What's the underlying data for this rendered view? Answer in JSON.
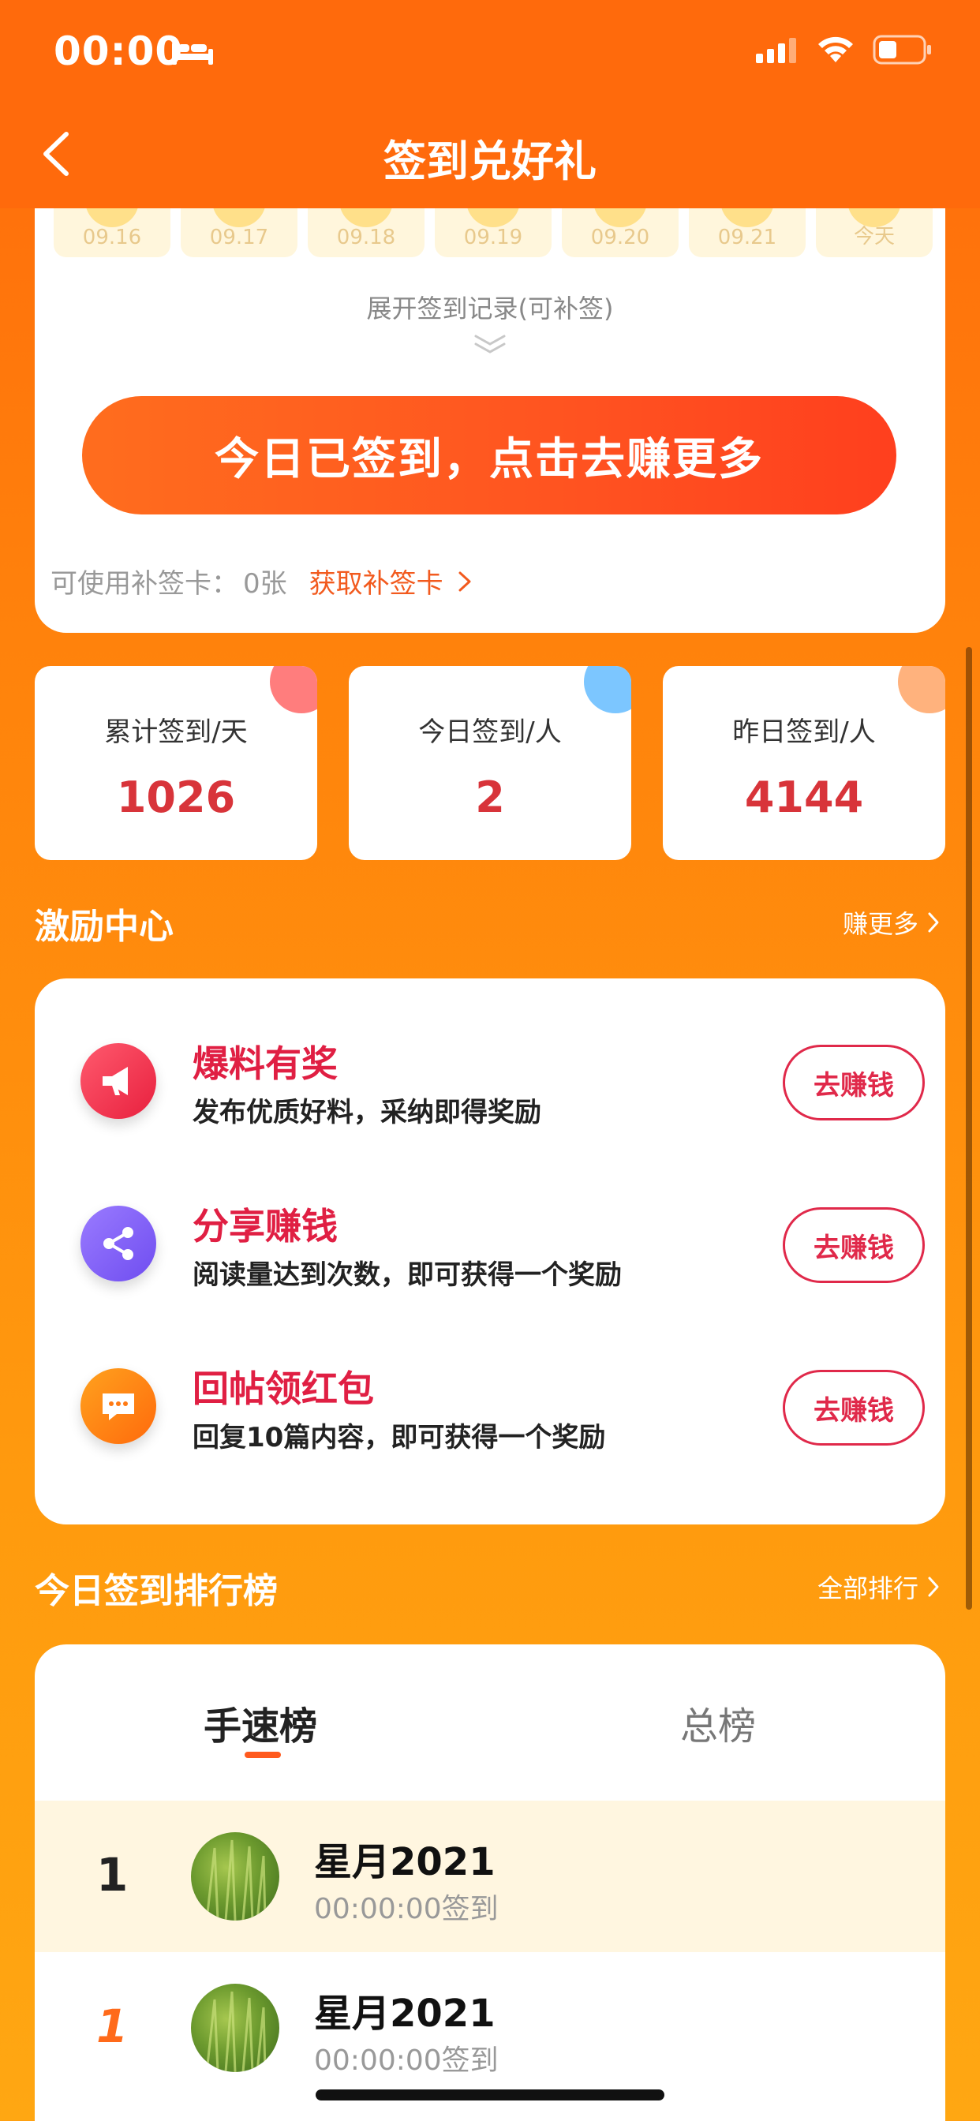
{
  "status_bar": {
    "time": "00:00"
  },
  "nav": {
    "title": "签到兑好礼"
  },
  "signin": {
    "dates": [
      "09.16",
      "09.17",
      "09.18",
      "09.19",
      "09.20",
      "09.21",
      "今天"
    ],
    "expand_text": "展开签到记录(可补签)",
    "button_label": "今日已签到，点击去赚更多",
    "makeup_label": "可使用补签卡：",
    "makeup_count": "0张",
    "makeup_link": "获取补签卡"
  },
  "stats": [
    {
      "label": "累计签到/天",
      "value": "1026"
    },
    {
      "label": "今日签到/人",
      "value": "2"
    },
    {
      "label": "昨日签到/人",
      "value": "4144"
    }
  ],
  "incentive": {
    "title": "激励中心",
    "more": "赚更多",
    "tasks": [
      {
        "title": "爆料有奖",
        "desc": "发布优质好料，采纳即得奖励",
        "button": "去赚钱"
      },
      {
        "title": "分享赚钱",
        "desc": "阅读量达到次数，即可获得一个奖励",
        "button": "去赚钱"
      },
      {
        "title": "回帖领红包",
        "desc": "回复10篇内容，即可获得一个奖励",
        "button": "去赚钱"
      }
    ]
  },
  "ranking": {
    "title": "今日签到排行榜",
    "more": "全部排行",
    "tabs": [
      "手速榜",
      "总榜"
    ],
    "rows": [
      {
        "rank": "1",
        "name": "星月2021",
        "time": "00:00:00签到"
      },
      {
        "rank": "1",
        "name": "星月2021",
        "time": "00:00:00签到"
      }
    ]
  },
  "colors": {
    "header": "#ff6a0c",
    "accent_red": "#e01f43",
    "stat_value": "#d8343a",
    "link": "#f25a1e"
  }
}
